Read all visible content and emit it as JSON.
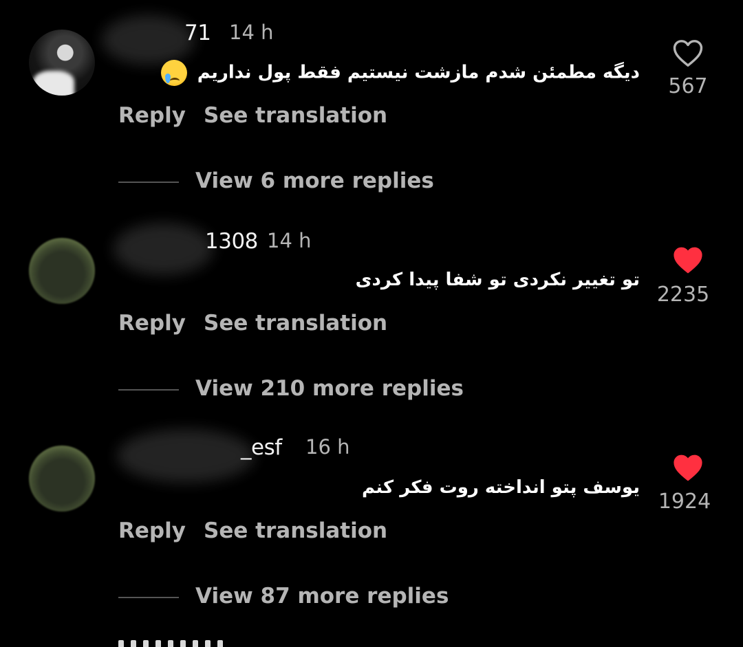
{
  "comments": [
    {
      "username": "71",
      "time": "14 h",
      "text": "دیگه مطمئن شدم مازشت نیستیم فقط پول نداریم",
      "emoji": "crying-face-emoji",
      "liked": false,
      "like_count": "567",
      "reply_label": "Reply",
      "translate_label": "See translation",
      "view_replies": "View 6 more replies"
    },
    {
      "username": "1308",
      "time": "14 h",
      "text": "تو تغییر نکردی تو شفا پیدا کردی",
      "liked": true,
      "like_count": "2235",
      "reply_label": "Reply",
      "translate_label": "See translation",
      "view_replies": "View 210 more replies"
    },
    {
      "username": "_esf",
      "time": "16 h",
      "text": "یوسف پتو انداخته روت فکر کنم",
      "liked": true,
      "like_count": "1924",
      "reply_label": "Reply",
      "translate_label": "See translation",
      "view_replies": "View 87 more replies"
    }
  ],
  "colors": {
    "background": "#000000",
    "primary_text": "#ffffff",
    "secondary_text": "#b5b5b5",
    "like_red": "#ff3040"
  }
}
